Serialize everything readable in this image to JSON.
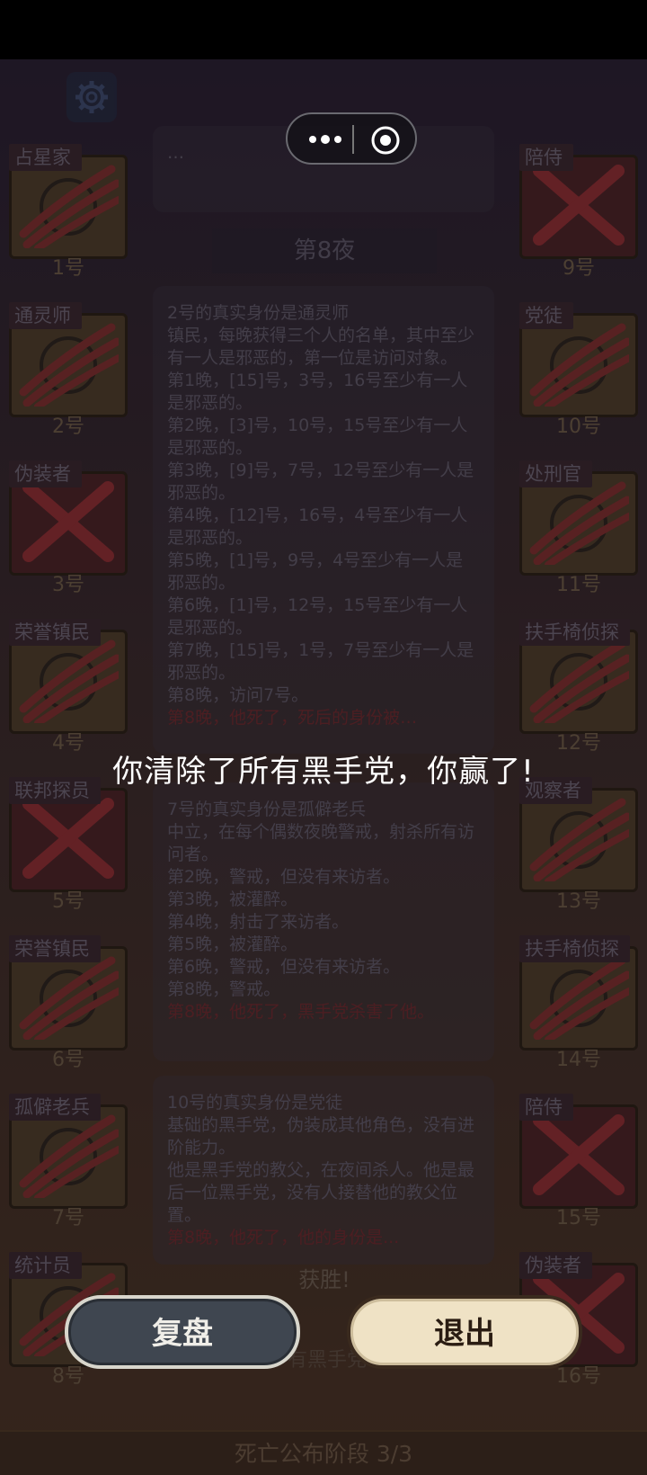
{
  "capsule": {
    "more_icon": "more-dots-icon",
    "close_icon": "target-close-icon"
  },
  "settings": {
    "icon": "gear-icon"
  },
  "left_cards": [
    {
      "role": "占星家",
      "number": "1号",
      "dead": false,
      "icon": "astrologer-icon"
    },
    {
      "role": "通灵师",
      "number": "2号",
      "dead": false,
      "icon": "crystal-ball-icon"
    },
    {
      "role": "伪装者",
      "number": "3号",
      "dead": true,
      "icon": "mask-icon"
    },
    {
      "role": "荣誉镇民",
      "number": "4号",
      "dead": false,
      "icon": "medal-icon"
    },
    {
      "role": "联邦探员",
      "number": "5号",
      "dead": true,
      "icon": "badge-icon"
    },
    {
      "role": "荣誉镇民",
      "number": "6号",
      "dead": false,
      "icon": "medal-icon"
    },
    {
      "role": "孤僻老兵",
      "number": "7号",
      "dead": false,
      "icon": "knife-icon"
    },
    {
      "role": "统计员",
      "number": "8号",
      "dead": false,
      "icon": "stats-icon"
    }
  ],
  "right_cards": [
    {
      "role": "陪侍",
      "number": "9号",
      "dead": true,
      "icon": "glass-icon"
    },
    {
      "role": "党徒",
      "number": "10号",
      "dead": false,
      "icon": "mafia-icon"
    },
    {
      "role": "处刑官",
      "number": "11号",
      "dead": false,
      "icon": "executioner-icon"
    },
    {
      "role": "扶手椅侦探",
      "number": "12号",
      "dead": false,
      "icon": "armchair-icon"
    },
    {
      "role": "观察者",
      "number": "13号",
      "dead": false,
      "icon": "binoculars-icon"
    },
    {
      "role": "扶手椅侦探",
      "number": "14号",
      "dead": false,
      "icon": "armchair-icon"
    },
    {
      "role": "陪侍",
      "number": "15号",
      "dead": true,
      "icon": "glass-icon"
    },
    {
      "role": "伪装者",
      "number": "16号",
      "dead": true,
      "icon": "mask-icon"
    }
  ],
  "log": {
    "night_header": "第8夜",
    "top_panel_lines": [
      "…",
      ""
    ],
    "panel1": {
      "title": "2号的真实身份是通灵师",
      "desc": "镇民，每晚获得三个人的名单，其中至少有一人是邪恶的，第一位是访问对象。",
      "lines": [
        "第1晚，[15]号，3号，16号至少有一人是邪恶的。",
        "第2晚，[3]号，10号，15号至少有一人是邪恶的。",
        "第3晚，[9]号，7号，12号至少有一人是邪恶的。",
        "第4晚，[12]号，16号，4号至少有一人是邪恶的。",
        "第5晚，[1]号，9号，4号至少有一人是邪恶的。",
        "第6晚，[1]号，12号，15号至少有一人是邪恶的。",
        "第7晚，[15]号，1号，7号至少有一人是邪恶的。",
        "第8晚，访问7号。"
      ],
      "red_line": "第8晚，他死了，死后的身份被…"
    },
    "panel2": {
      "title": "7号的真实身份是孤僻老兵",
      "desc": "中立，在每个偶数夜晚警戒，射杀所有访问者。",
      "lines": [
        "第2晚，警戒，但没有来访者。",
        "第3晚，被灌醉。",
        "第4晚，射击了来访者。",
        "第5晚，被灌醉。",
        "第6晚，警戒，但没有来访者。",
        "第8晚，警戒。"
      ],
      "red_line": "第8晚，他死了，黑手党杀害了他。"
    },
    "panel3": {
      "title": "10号的真实身份是党徒",
      "desc": "基础的黑手党，伪装成其他角色，没有进阶能力。",
      "desc2": "他是黑手党的教父，在夜间杀人。他是最后一位黑手党，没有人接替他的教父位置。",
      "red_line": "第8晚，他死了，他的身份是..."
    },
    "victory_header": "获胜!",
    "victory_line": "有黑手党"
  },
  "message": "你清除了所有黑手党，你赢了!",
  "buttons": {
    "replay": "复盘",
    "exit": "退出"
  },
  "phase_bar": "死亡公布阶段 3/3"
}
